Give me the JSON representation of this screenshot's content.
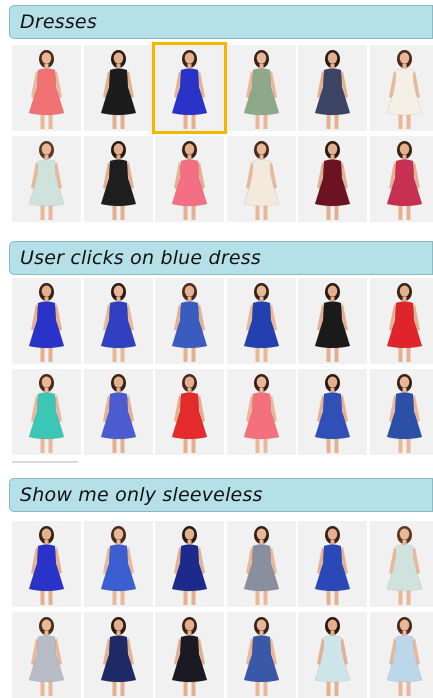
{
  "sections": [
    {
      "title": "Dresses",
      "rows": [
        [
          {
            "dress": "coral-sleeveless-dress",
            "color": "#f07272",
            "skin": "#e8b898",
            "hair": "#4a2a1a"
          },
          {
            "dress": "black-sleeveless-dress",
            "color": "#1c1c1c",
            "skin": "#e2b090",
            "hair": "#2a1a10"
          },
          {
            "dress": "blue-sleeveless-dress",
            "color": "#2a33c8",
            "skin": "#e4b090",
            "hair": "#3a2214"
          },
          {
            "dress": "floral-print-dress",
            "color": "#8ea88a",
            "skin": "#e8b898",
            "hair": "#3a2214"
          },
          {
            "dress": "printed-navy-dress",
            "color": "#3c4466",
            "skin": "#e4b090",
            "hair": "#2a1a10"
          },
          {
            "dress": "white-sleeveless-dress",
            "color": "#f4f0e6",
            "skin": "#e8b898",
            "hair": "#4a2a1a"
          }
        ],
        [
          {
            "dress": "mint-blouson-dress",
            "color": "#cfe3dc",
            "skin": "#e8b898",
            "hair": "#5a3a22"
          },
          {
            "dress": "black-lace-dress",
            "color": "#1e1e1e",
            "skin": "#e2b090",
            "hair": "#2a1a10"
          },
          {
            "dress": "pink-sleeveless-dress",
            "color": "#f46f84",
            "skin": "#e4b090",
            "hair": "#3a2214"
          },
          {
            "dress": "cream-sleeved-dress",
            "color": "#f3e9dc",
            "skin": "#e8b898",
            "hair": "#4a2a1a"
          },
          {
            "dress": "maroon-dress",
            "color": "#6b1320",
            "skin": "#e2b090",
            "hair": "#2a1a10"
          },
          {
            "dress": "floral-red-dress",
            "color": "#c73050",
            "skin": "#e4b090",
            "hair": "#3a2214"
          }
        ]
      ]
    },
    {
      "title": "User clicks on blue dress",
      "rows": [
        [
          {
            "dress": "blue-sleeveless-dress",
            "color": "#2a33c8",
            "skin": "#e4b090",
            "hair": "#3a2214"
          },
          {
            "dress": "blue-cap-sleeve-dress",
            "color": "#3140c0",
            "skin": "#e8b898",
            "hair": "#2a1a10"
          },
          {
            "dress": "blue-layered-dress",
            "color": "#3a5cc0",
            "skin": "#e4b090",
            "hair": "#4a2a1a"
          },
          {
            "dress": "blue-a-line-dress",
            "color": "#2440b0",
            "skin": "#e8b898",
            "hair": "#3a2214"
          },
          {
            "dress": "black-sheer-yoke-dress",
            "color": "#1a1a1a",
            "skin": "#e2b090",
            "hair": "#2a1a10"
          },
          {
            "dress": "red-sleeveless-dress",
            "color": "#e0242c",
            "skin": "#e4b090",
            "hair": "#3a2214"
          }
        ],
        [
          {
            "dress": "teal-sleeveless-dress",
            "color": "#3cc6b6",
            "skin": "#e8b898",
            "hair": "#4a2a1a"
          },
          {
            "dress": "blue-wrap-dress",
            "color": "#4a5cd0",
            "skin": "#e4b090",
            "hair": "#3a2214"
          },
          {
            "dress": "red-shift-dress",
            "color": "#e32b2b",
            "skin": "#e2b090",
            "hair": "#4a2a1a"
          },
          {
            "dress": "pink-skater-dress",
            "color": "#f4707c",
            "skin": "#e8b898",
            "hair": "#3a2214"
          },
          {
            "dress": "blue-layered-dress",
            "color": "#3050b8",
            "skin": "#e4b090",
            "hair": "#2a1a10"
          },
          {
            "dress": "blue-printed-dress",
            "color": "#2c4fa8",
            "skin": "#e8b898",
            "hair": "#3a2214"
          }
        ]
      ]
    },
    {
      "title": "Show me only sleeveless",
      "rows": [
        [
          {
            "dress": "blue-sleeveless-dress",
            "color": "#2a33c8",
            "skin": "#e4b090",
            "hair": "#3a2214"
          },
          {
            "dress": "blue-skater-dress",
            "color": "#3b5fd0",
            "skin": "#e8b898",
            "hair": "#4a2a1a"
          },
          {
            "dress": "navy-blue-panel-dress",
            "color": "#1c2a8c",
            "skin": "#e4b090",
            "hair": "#2a1a10"
          },
          {
            "dress": "grey-striped-maxi-dress",
            "color": "#8a8fa0",
            "skin": "#e8b898",
            "hair": "#3a2214"
          },
          {
            "dress": "blue-a-line-dress",
            "color": "#2a48b8",
            "skin": "#e4b090",
            "hair": "#3a2214"
          },
          {
            "dress": "mint-blouson-dress",
            "color": "#cfe3dc",
            "skin": "#e8b898",
            "hair": "#5a3a22"
          }
        ],
        [
          {
            "dress": "grey-blouson-dress",
            "color": "#b8bcc6",
            "skin": "#e8b898",
            "hair": "#4a2a1a"
          },
          {
            "dress": "navy-dress",
            "color": "#1e2a66",
            "skin": "#e4b090",
            "hair": "#2a1a10"
          },
          {
            "dress": "black-open-back-dress",
            "color": "#1a1a22",
            "skin": "#e2b090",
            "hair": "#3a2214"
          },
          {
            "dress": "blue-print-dress",
            "color": "#3b58a8",
            "skin": "#e8b898",
            "hair": "#3a2214"
          },
          {
            "dress": "mint-dress",
            "color": "#cde6ea",
            "skin": "#e4b090",
            "hair": "#2a1a10"
          },
          {
            "dress": "light-blue-lace-dress",
            "color": "#bcd6ea",
            "skin": "#e8b898",
            "hair": "#4a2a1a"
          }
        ]
      ]
    }
  ],
  "selected": {
    "section": 0,
    "row": 0,
    "col": 2,
    "color": "#f4b700"
  }
}
